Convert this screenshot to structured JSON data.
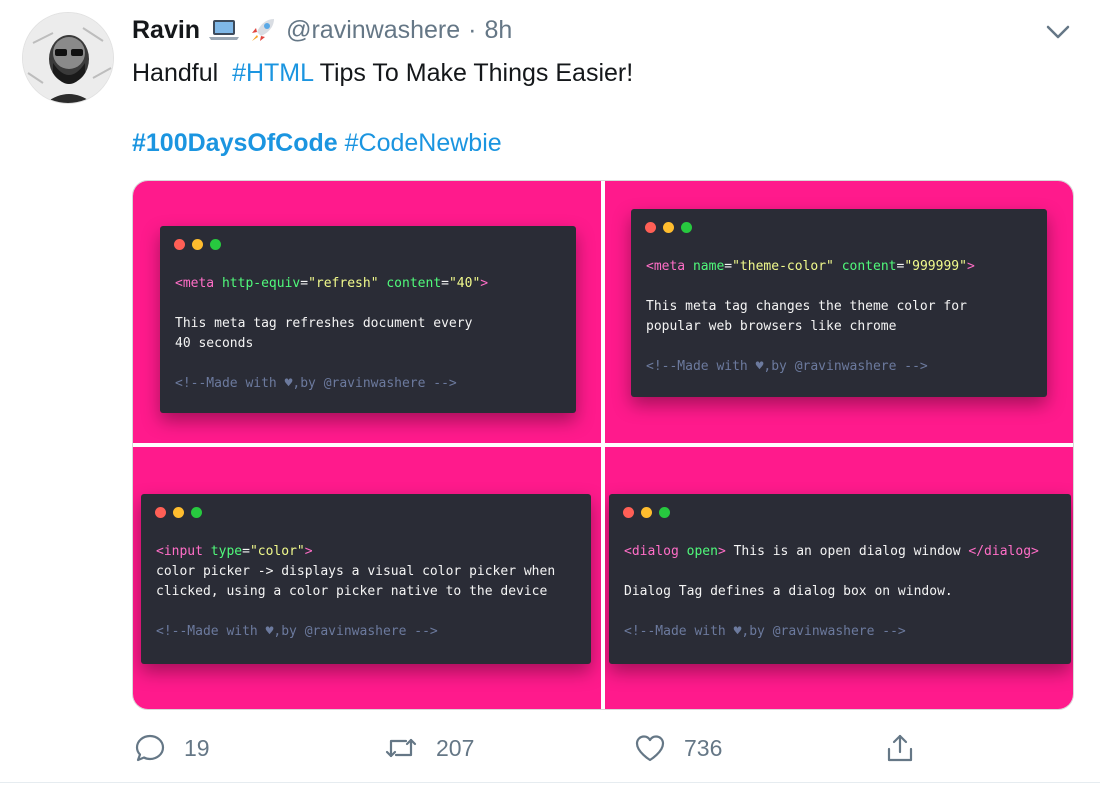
{
  "tweet": {
    "author_name": "Ravin",
    "author_emojis": [
      "laptop-emoji",
      "rocket-emoji"
    ],
    "handle": "@ravinwashere",
    "separator": "·",
    "time": "8h",
    "text_prefix": "Handful",
    "text_hashtag": "#HTML",
    "text_suffix": "Tips To Make Things Easier!",
    "hashtag_1": "#100DaysOfCode",
    "hashtag_2": "#CodeNewbie"
  },
  "media": {
    "background_color": "#ff1a8c",
    "cards": [
      {
        "code": {
          "open": "<meta",
          "attr1": "http-equiv",
          "val1": "\"refresh\"",
          "attr2": "content",
          "val2": "\"40\"",
          "close": ">"
        },
        "desc_1": "This meta tag refreshes document every",
        "desc_2": "40 seconds",
        "footer": "<!--Made with ♥,by @ravinwashere -->"
      },
      {
        "code": {
          "open": "<meta",
          "attr1": "name",
          "val1": "\"theme-color\"",
          "attr2": "content",
          "val2": "\"999999\"",
          "close": ">"
        },
        "desc_1": "This meta tag changes the theme color for",
        "desc_2": "popular web browsers like chrome",
        "footer": "<!--Made with ♥,by @ravinwashere -->"
      },
      {
        "code": {
          "open": "<input",
          "attr1": "type",
          "val1": "\"color\"",
          "close": ">"
        },
        "desc_1": "color picker -> displays a visual color picker when",
        "desc_2": "clicked, using a color picker native to the device",
        "footer": "<!--Made with ♥,by @ravinwashere -->"
      },
      {
        "code": {
          "open": "<dialog",
          "attr1": "open",
          "close": ">",
          "text": " This is an open dialog window ",
          "end": "</dialog>"
        },
        "desc_1": "Dialog Tag defines a dialog box on window.",
        "footer": "<!--Made with ♥,by @ravinwashere -->"
      }
    ]
  },
  "actions": {
    "reply_count": "19",
    "retweet_count": "207",
    "like_count": "736"
  },
  "colors": {
    "link": "#1b95e0",
    "muted": "#657786"
  }
}
